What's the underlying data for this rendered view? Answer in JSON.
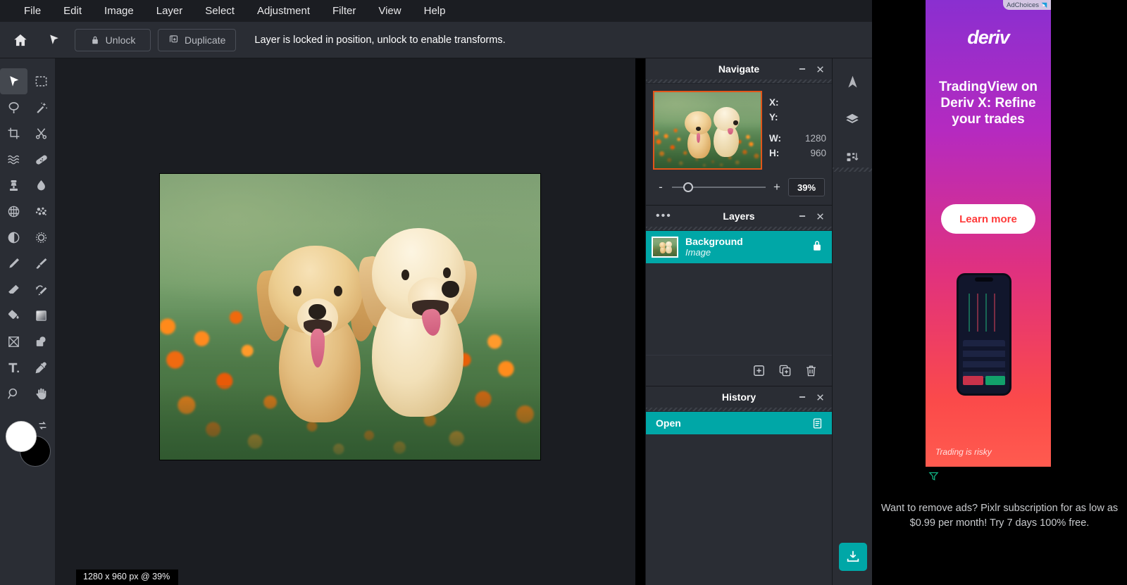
{
  "menubar": {
    "items": [
      {
        "label": "File"
      },
      {
        "label": "Edit"
      },
      {
        "label": "Image"
      },
      {
        "label": "Layer"
      },
      {
        "label": "Select"
      },
      {
        "label": "Adjustment"
      },
      {
        "label": "Filter"
      },
      {
        "label": "View"
      },
      {
        "label": "Help"
      }
    ]
  },
  "optionbar": {
    "home_icon": "home-icon",
    "arrange_icon": "arrange-cursor-icon",
    "unlock_label": "Unlock",
    "unlock_icon": "lock-icon",
    "duplicate_label": "Duplicate",
    "duplicate_icon": "duplicate-icon",
    "hint": "Layer is locked in position, unlock to enable transforms."
  },
  "toolbar": {
    "tools": [
      {
        "name": "arrange-tool",
        "active": true
      },
      {
        "name": "marquee-select-tool",
        "active": false
      },
      {
        "name": "lasso-select-tool",
        "active": false
      },
      {
        "name": "magic-wand-tool",
        "active": false
      },
      {
        "name": "crop-tool",
        "active": false
      },
      {
        "name": "cutout-tool",
        "active": false
      },
      {
        "name": "liquify-tool",
        "active": false
      },
      {
        "name": "heal-tool",
        "active": false
      },
      {
        "name": "clone-stamp-tool",
        "active": false
      },
      {
        "name": "blur-tool",
        "active": false
      },
      {
        "name": "detail-tool",
        "active": false
      },
      {
        "name": "dispersion-tool",
        "active": false
      },
      {
        "name": "toning-tool",
        "active": false
      },
      {
        "name": "effects-tool",
        "active": false
      },
      {
        "name": "pen-tool",
        "active": false
      },
      {
        "name": "paint-brush-tool",
        "active": false
      },
      {
        "name": "eraser-tool",
        "active": false
      },
      {
        "name": "retouch-brush-tool",
        "active": false
      },
      {
        "name": "paint-bucket-tool",
        "active": false
      },
      {
        "name": "gradient-tool",
        "active": false
      },
      {
        "name": "shape-tool",
        "active": false
      },
      {
        "name": "add-element-tool",
        "active": false
      },
      {
        "name": "text-tool",
        "active": false
      },
      {
        "name": "color-picker-tool",
        "active": false
      },
      {
        "name": "zoom-tool",
        "active": false
      },
      {
        "name": "hand-tool",
        "active": false
      }
    ],
    "foreground_color": "#ffffff",
    "background_color": "#000000",
    "swap_icon": "swap-colors-icon"
  },
  "canvas": {
    "status": "1280 x 960 px @ 39%",
    "image_alt": "two golden retriever puppies sitting in a field of orange flowers"
  },
  "navigate": {
    "title": "Navigate",
    "minimize_icon": "minimize-icon",
    "close_icon": "close-icon",
    "thumb_border_color": "#e2561a",
    "fields": [
      {
        "key": "X:",
        "value": ""
      },
      {
        "key": "Y:",
        "value": ""
      },
      {
        "key": "W:",
        "value": "1280"
      },
      {
        "key": "H:",
        "value": "960"
      }
    ],
    "zoom_out_label": "-",
    "zoom_in_label": "+",
    "zoom_value": "39%",
    "slider_position_pct": 12
  },
  "layers": {
    "title": "Layers",
    "menu_icon": "more-options-icon",
    "minimize_icon": "minimize-icon",
    "close_icon": "close-icon",
    "selected_color": "#00a7a7",
    "items": [
      {
        "name": "Background",
        "type": "Image",
        "locked": true,
        "lock_icon": "lock-icon"
      }
    ],
    "actions": [
      {
        "name": "add-layer-button",
        "icon": "plus-square-icon"
      },
      {
        "name": "duplicate-layer-button",
        "icon": "duplicate-layer-icon"
      },
      {
        "name": "delete-layer-button",
        "icon": "trash-icon"
      }
    ]
  },
  "history": {
    "title": "History",
    "minimize_icon": "minimize-icon",
    "close_icon": "close-icon",
    "selected_color": "#00a7a7",
    "items": [
      {
        "label": "Open",
        "icon": "document-list-icon"
      }
    ]
  },
  "iconstrip": {
    "buttons": [
      {
        "name": "navigate-panel-toggle",
        "icon": "navigate-arrow-icon"
      },
      {
        "name": "layers-panel-toggle",
        "icon": "layers-stack-icon"
      },
      {
        "name": "history-panel-toggle",
        "icon": "history-icon"
      }
    ],
    "save_button": {
      "name": "save-download-button",
      "icon": "download-icon",
      "color": "#00a7a7"
    }
  },
  "ad": {
    "adchoices_label": "AdChoices",
    "adchoices_icon": "adchoices-triangle-icon",
    "brand": "deriv",
    "headline": "TradingView on Deriv X: Refine your trades",
    "cta_label": "Learn more",
    "risk_note": "Trading is risky",
    "ad_flag_icon": "ad-flag-icon",
    "promo": "Want to remove ads? Pixlr subscription for as low as $0.99 per month! Try 7 days 100% free."
  }
}
